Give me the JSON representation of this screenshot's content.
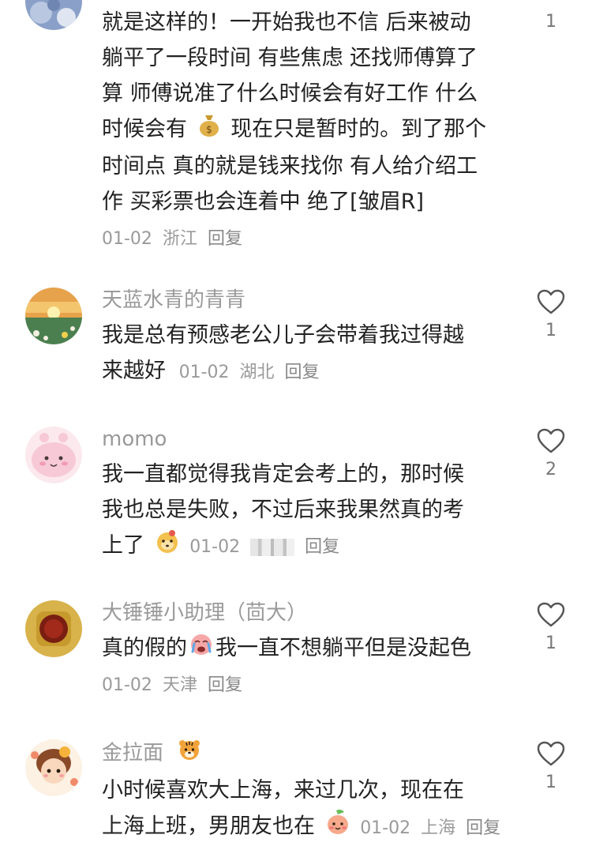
{
  "comments": [
    {
      "username": "",
      "text_lines": [
        "就是这样的！一开始我也不信 后来被动",
        "躺平了一段时间 有些焦虑 还找师傅算了",
        "算 师傅说准了什么时候会有好工作 什么",
        "时候会有",
        "现在只是暂时的。到了那个",
        "时间点 真的就是钱来找你 有人给介绍工",
        "作 买彩票也会连着中 绝了[皱眉R]"
      ],
      "date": "01-02",
      "location": "浙江",
      "reply_label": "回复",
      "likes": "1",
      "avatar_icon": "marble-avatar-icon"
    },
    {
      "username": "天蓝水青的青青",
      "text_lines": [
        "我是总有预感老公儿子会带着我过得越",
        "来越好"
      ],
      "date": "01-02",
      "location": "湖北",
      "reply_label": "回复",
      "likes": "1",
      "avatar_icon": "sunset-landscape-avatar-icon"
    },
    {
      "username": "momo",
      "text_lines": [
        "我一直都觉得我肯定会考上的，那时候",
        "我也总是失败，不过后来我果然真的考",
        "上了"
      ],
      "date": "01-02",
      "location": "",
      "reply_label": "回复",
      "likes": "2",
      "avatar_icon": "pink-cartoon-avatar-icon"
    },
    {
      "username": "大锤锤小助理（茴大）",
      "text_lines": [
        "真的假的",
        "我一直不想躺平但是没起色"
      ],
      "date": "01-02",
      "location": "天津",
      "reply_label": "回复",
      "likes": "1",
      "avatar_icon": "red-tea-cup-avatar-icon"
    },
    {
      "username": "金拉面",
      "text_lines": [
        "小时候喜欢大上海，来过几次，现在在",
        "上海上班，男朋友也在"
      ],
      "date": "01-02",
      "location": "上海",
      "reply_label": "回复",
      "likes": "1",
      "avatar_icon": "cartoon-girl-avatar-icon"
    }
  ],
  "colors": {
    "text": "#222222",
    "meta": "#9a9a9a",
    "icon": "#555555"
  },
  "icons": {
    "like": "heart-outline-icon",
    "money": "money-bag-emoji-icon",
    "cry": "crying-face-emoji-icon",
    "monkey": "cute-face-emoji-icon",
    "peach": "peach-face-emoji-icon",
    "tiger": "tiger-emoji-icon"
  }
}
